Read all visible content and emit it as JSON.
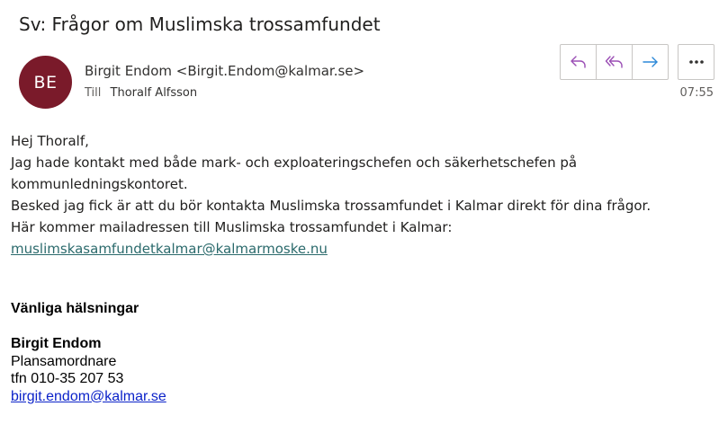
{
  "message": {
    "subject": "Sv: Frågor om Muslimska trossamfundet",
    "sender": {
      "initials": "BE",
      "display": "Birgit Endom <Birgit.Endom@kalmar.se>",
      "avatar_color": "#7a1a2a"
    },
    "to_label": "Till",
    "to_name": "Thoralf Alfsson",
    "time": "07:55"
  },
  "actions": {
    "reply": "reply-icon",
    "reply_all": "reply-all-icon",
    "forward": "forward-icon",
    "more": "more-icon",
    "reply_color": "#9b4fb5",
    "forward_color": "#2b88d8"
  },
  "body": {
    "greeting": "Hej Thoralf,",
    "line1": "Jag hade kontakt med både mark- och exploateringschefen och säkerhetschefen på",
    "line2": "kommunledningskontoret.",
    "line3": "Besked jag fick är att du bör kontakta Muslimska trossamfundet i Kalmar direkt för dina frågor.",
    "line4": "Här kommer mailadressen till Muslimska trossamfundet i Kalmar:",
    "email_link": "muslimskasamfundetkalmar@kalmarmoske.nu"
  },
  "signature": {
    "closing": "Vänliga hälsningar",
    "name": "Birgit Endom",
    "title": "Plansamordnare",
    "phone": "tfn 010-35 207 53",
    "email": "birgit.endom@kalmar.se"
  }
}
